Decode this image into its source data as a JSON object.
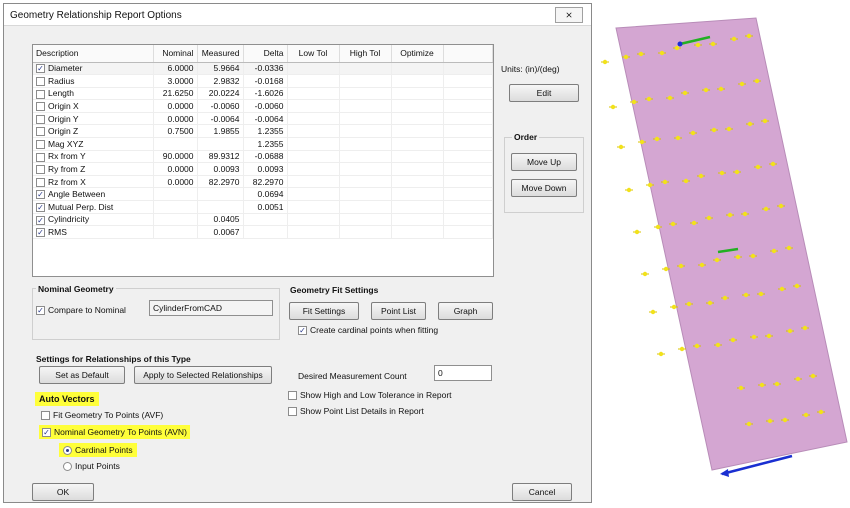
{
  "window": {
    "title": "Geometry Relationship Report Options",
    "close_glyph": "⨯"
  },
  "grid": {
    "headers": [
      "Description",
      "Nominal",
      "Measured",
      "Delta",
      "Low Tol",
      "High Tol",
      "Optimize"
    ],
    "rows": [
      {
        "checked": true,
        "desc": "Diameter",
        "nominal": "6.0000",
        "measured": "5.9664",
        "delta": "-0.0336"
      },
      {
        "checked": false,
        "desc": "Radius",
        "nominal": "3.0000",
        "measured": "2.9832",
        "delta": "-0.0168"
      },
      {
        "checked": false,
        "desc": "Length",
        "nominal": "21.6250",
        "measured": "20.0224",
        "delta": "-1.6026"
      },
      {
        "checked": false,
        "desc": "Origin X",
        "nominal": "0.0000",
        "measured": "-0.0060",
        "delta": "-0.0060"
      },
      {
        "checked": false,
        "desc": "Origin Y",
        "nominal": "0.0000",
        "measured": "-0.0064",
        "delta": "-0.0064"
      },
      {
        "checked": false,
        "desc": "Origin Z",
        "nominal": "0.7500",
        "measured": "1.9855",
        "delta": "1.2355"
      },
      {
        "checked": false,
        "desc": "Mag XYZ",
        "nominal": "",
        "measured": "",
        "delta": "1.2355"
      },
      {
        "checked": false,
        "desc": "Rx from Y",
        "nominal": "90.0000",
        "measured": "89.9312",
        "delta": "-0.0688"
      },
      {
        "checked": false,
        "desc": "Ry from Z",
        "nominal": "0.0000",
        "measured": "0.0093",
        "delta": "0.0093"
      },
      {
        "checked": false,
        "desc": "Rz from X",
        "nominal": "0.0000",
        "measured": "82.2970",
        "delta": "82.2970"
      },
      {
        "checked": true,
        "desc": "Angle Between",
        "nominal": "",
        "measured": "",
        "delta": "0.0694"
      },
      {
        "checked": true,
        "desc": "Mutual Perp. Dist",
        "nominal": "",
        "measured": "",
        "delta": "0.0051"
      },
      {
        "checked": true,
        "desc": "Cylindricity",
        "nominal": "",
        "measured": "0.0405",
        "delta": ""
      },
      {
        "checked": true,
        "desc": "RMS",
        "nominal": "",
        "measured": "0.0067",
        "delta": ""
      }
    ]
  },
  "right_panel": {
    "units": "Units: (in)/(deg)",
    "edit_label": "Edit",
    "order_label": "Order",
    "move_up_label": "Move Up",
    "move_down_label": "Move Down"
  },
  "nominal_geometry": {
    "heading": "Nominal Geometry",
    "compare_label": "Compare to Nominal",
    "compare_checked": true,
    "nominal_value": "CylinderFromCAD"
  },
  "fit_settings": {
    "heading": "Geometry Fit Settings",
    "fit_settings_label": "Fit Settings",
    "point_list_label": "Point List",
    "graph_label": "Graph",
    "cardinal_label": "Create cardinal points when fitting",
    "cardinal_checked": true,
    "measurement_count_label": "Desired Measurement Count",
    "measurement_count_value": "0",
    "show_tol_label": "Show High and Low Tolerance in Report",
    "show_point_list_label": "Show Point List Details in Report"
  },
  "relationships": {
    "heading": "Settings for Relationships of this Type",
    "set_default_label": "Set as Default",
    "apply_label": "Apply to Selected Relationships"
  },
  "auto_vectors": {
    "heading": "Auto Vectors",
    "avf_label": "Fit Geometry To Points (AVF)",
    "avf_checked": false,
    "avn_label": "Nominal Geometry To Points (AVN)",
    "avn_checked": true,
    "cardinal_points_label": "Cardinal Points",
    "input_points_label": "Input Points",
    "selected": "Cardinal Points"
  },
  "footer": {
    "ok_label": "OK",
    "cancel_label": "Cancel"
  },
  "colors": {
    "highlight": "#ffff3a",
    "cylinder": "#d4a6d2",
    "point": "#f2e21a",
    "vector_green": "#22b022",
    "vector_blue": "#1a2fd1"
  }
}
